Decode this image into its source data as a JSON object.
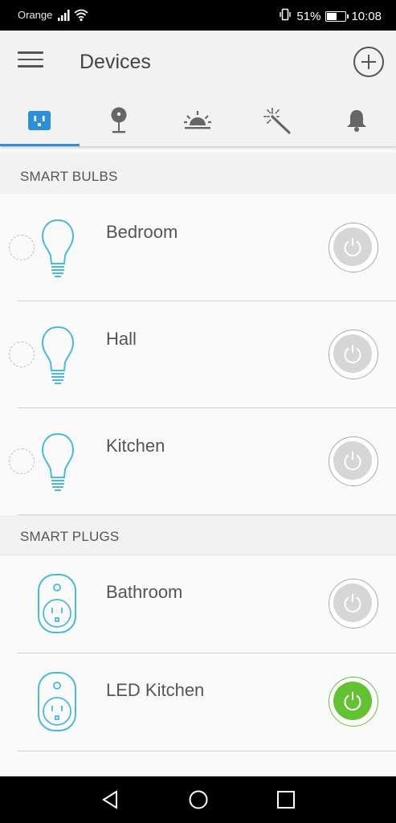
{
  "status_bar": {
    "carrier": "Orange",
    "battery_percent": "51%",
    "battery_level": 0.51,
    "time": "10:08",
    "icons": [
      "signal-icon",
      "wifi-icon",
      "vibrate-icon",
      "battery-icon"
    ]
  },
  "app_bar": {
    "title": "Devices",
    "menu_icon": "hamburger-menu-icon",
    "add_icon": "add-circle-icon"
  },
  "tabs": [
    {
      "icon": "smart-plug-icon",
      "active": true
    },
    {
      "icon": "camera-icon",
      "active": false
    },
    {
      "icon": "sunrise-icon",
      "active": false
    },
    {
      "icon": "magic-wand-icon",
      "active": false
    },
    {
      "icon": "bell-icon",
      "active": false
    }
  ],
  "sections": {
    "bulbs": {
      "title": "SMART BULBS",
      "devices": [
        {
          "name": "Bedroom",
          "on": false,
          "icon": "light-bulb-icon"
        },
        {
          "name": "Hall",
          "on": false,
          "icon": "light-bulb-icon"
        },
        {
          "name": "Kitchen",
          "on": false,
          "icon": "light-bulb-icon"
        }
      ]
    },
    "plugs": {
      "title": "SMART PLUGS",
      "devices": [
        {
          "name": "Bathroom",
          "on": false,
          "icon": "smart-plug-icon"
        },
        {
          "name": "LED Kitchen",
          "on": true,
          "icon": "smart-plug-icon"
        }
      ]
    }
  },
  "colors": {
    "accent": "#2b8fd9",
    "device_icon": "#4bb8dc",
    "power_on": "#63c234",
    "power_off": "#d6d6d6"
  },
  "nav_bar": {
    "buttons": [
      "back-icon",
      "home-icon",
      "recents-icon"
    ]
  }
}
